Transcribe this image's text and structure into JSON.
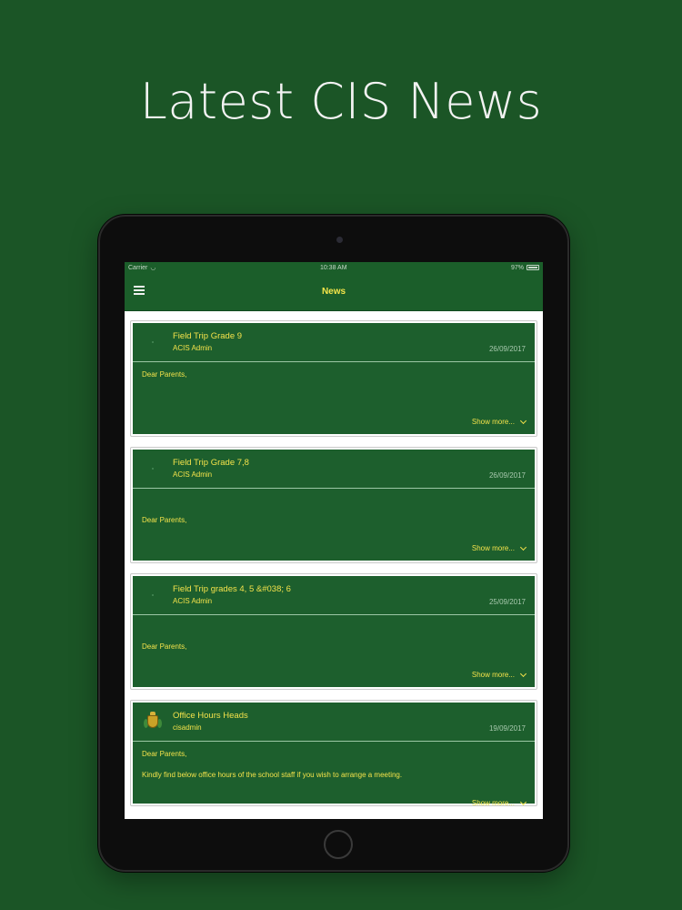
{
  "headline": "Latest CIS News",
  "statusbar": {
    "carrier": "Carrier",
    "time": "10:38 AM",
    "battery": "97%"
  },
  "navbar": {
    "title": "News"
  },
  "news": [
    {
      "title": "Field Trip Grade 9",
      "author": "ACIS Admin",
      "date": "26/09/2017",
      "greeting": "Dear Parents,",
      "body": "",
      "show_more": "Show more..."
    },
    {
      "title": "Field Trip Grade 7,8",
      "author": "ACIS Admin",
      "date": "26/09/2017",
      "greeting": "Dear Parents,",
      "body": "",
      "show_more": "Show more..."
    },
    {
      "title": "Field Trip grades 4, 5 &#038; 6",
      "author": "ACIS Admin",
      "date": "25/09/2017",
      "greeting": "Dear Parents,",
      "body": "",
      "show_more": "Show more..."
    },
    {
      "title": "Office Hours Heads",
      "author": "cisadmin",
      "date": "19/09/2017",
      "greeting": "Dear Parents,",
      "body": "Kindly find below office hours of the school staff if you wish to arrange a meeting.",
      "show_more": "Show more..."
    }
  ],
  "icons": {
    "menu": "hamburger-menu-icon",
    "wifi": "wifi-icon",
    "battery": "battery-icon",
    "chevron": "chevron-down-icon",
    "crest": "school-crest-icon"
  },
  "colors": {
    "background": "#1b5526",
    "accent": "#f3e24b",
    "card": "#1d5f2d"
  }
}
